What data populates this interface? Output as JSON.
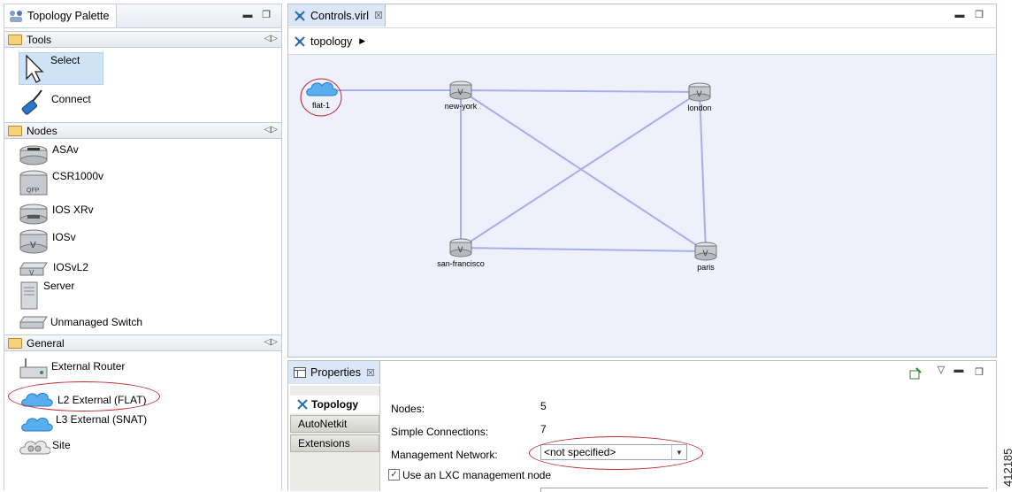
{
  "palette": {
    "title": "Topology Palette",
    "tools_header": "Tools",
    "tools": [
      {
        "label": "Select",
        "icon": "arrow-cursor-icon"
      },
      {
        "label": "Connect",
        "icon": "cable-plug-icon"
      }
    ],
    "nodes_header": "Nodes",
    "nodes": [
      {
        "label": "ASAv",
        "icon": "firewall-icon"
      },
      {
        "label": "CSR1000v",
        "icon": "router-qfp-icon"
      },
      {
        "label": "IOS XRv",
        "icon": "router-xr-icon"
      },
      {
        "label": "IOSv",
        "icon": "router-icon"
      },
      {
        "label": "IOSvL2",
        "icon": "switch-icon"
      },
      {
        "label": "Server",
        "icon": "server-icon"
      },
      {
        "label": "Unmanaged Switch",
        "icon": "unmanaged-switch-icon"
      }
    ],
    "general_header": "General",
    "general": [
      {
        "label": "External Router",
        "icon": "external-router-icon"
      },
      {
        "label": "L2 External (FLAT)",
        "icon": "cloud-icon"
      },
      {
        "label": "L3 External (SNAT)",
        "icon": "cloud-icon"
      },
      {
        "label": "Site",
        "icon": "site-icon"
      }
    ]
  },
  "editor": {
    "tab_title": "Controls.virl",
    "breadcrumb": "topology",
    "nodes": [
      {
        "id": "flat-1",
        "label": "flat-1",
        "kind": "cloud"
      },
      {
        "id": "new-york",
        "label": "new-york",
        "kind": "router"
      },
      {
        "id": "london",
        "label": "london",
        "kind": "router"
      },
      {
        "id": "san-francisco",
        "label": "san-francisco",
        "kind": "router"
      },
      {
        "id": "paris",
        "label": "paris",
        "kind": "router"
      }
    ],
    "links": [
      [
        "flat-1",
        "new-york"
      ],
      [
        "new-york",
        "london"
      ],
      [
        "new-york",
        "san-francisco"
      ],
      [
        "new-york",
        "paris"
      ],
      [
        "london",
        "san-francisco"
      ],
      [
        "london",
        "paris"
      ],
      [
        "san-francisco",
        "paris"
      ]
    ],
    "link_color": "#a9aeea"
  },
  "properties": {
    "tab_title": "Properties",
    "side_tabs": [
      "Topology",
      "AutoNetkit",
      "Extensions"
    ],
    "rows": [
      {
        "label": "Nodes:",
        "value": "5"
      },
      {
        "label": "Simple Connections:",
        "value": "7"
      },
      {
        "label": "Management Network:",
        "value": "<not specified>"
      }
    ],
    "lxc_label": "Use an LXC management node",
    "lxc_checked": true
  },
  "figure_id": "412185",
  "colors": {
    "highlight_oval": "#c0282e",
    "selection": "#cfe3f7",
    "canvas_bg": "#eef0fb"
  }
}
